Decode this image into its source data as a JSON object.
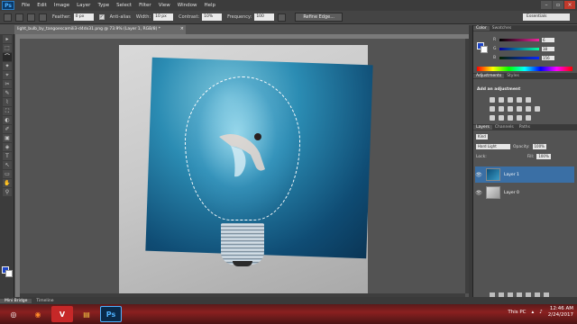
{
  "app": {
    "logo": "Ps"
  },
  "menu": [
    "File",
    "Edit",
    "Image",
    "Layer",
    "Type",
    "Select",
    "Filter",
    "View",
    "Window",
    "Help"
  ],
  "options": {
    "feather_label": "Feather:",
    "feather_value": "0 px",
    "antialias_label": "Anti-alias",
    "width_label": "Width:",
    "width_value": "10 px",
    "contrast_label": "Contrast:",
    "contrast_value": "10%",
    "frequency_label": "Frequency:",
    "frequency_value": "100",
    "refine_label": "Refine Edge...",
    "workspace": "Essentials"
  },
  "document": {
    "tab_title": "light_bulb_by_tangoescamili3-d4dx31.png @ 73.9% (Layer 1, RGB/8) *",
    "close_glyph": "×"
  },
  "tools": [
    "▸",
    "⬚",
    "⌒",
    "✦",
    "⌖",
    "✂",
    "✎",
    "⌇",
    "⛶",
    "◐",
    "✐",
    "▣",
    "◈",
    "T",
    "↖",
    "▭",
    "✋",
    "⚲"
  ],
  "panels": {
    "color_tabs": [
      "Color",
      "Swatches"
    ],
    "color": {
      "r_label": "R",
      "r_value": "6",
      "g_label": "G",
      "g_value": "38",
      "b_label": "B",
      "b_value": "156"
    },
    "adj_tabs": [
      "Adjustments",
      "Styles"
    ],
    "adj_title": "Add an adjustment",
    "layers_tabs": [
      "Layers",
      "Channels",
      "Paths"
    ],
    "kind_label": "Kind",
    "blend_mode": "Hard Light",
    "opacity_label": "Opacity:",
    "opacity_value": "100%",
    "lock_label": "Lock:",
    "fill_label": "Fill:",
    "fill_value": "100%",
    "layers": [
      {
        "name": "Layer 1",
        "selected": true
      },
      {
        "name": "Layer 0",
        "selected": false
      }
    ]
  },
  "statusbar": {
    "tabs": [
      "Mini Bridge",
      "Timeline"
    ]
  },
  "taskbar": {
    "items": [
      "◎",
      "◉",
      "V",
      "▤",
      "Ps"
    ],
    "tray_label": "This PC",
    "time": "12:46 AM",
    "date": "2/24/2017"
  },
  "colors": {
    "foreground": "#1d44c6",
    "background": "#ffffff",
    "selection": "#3a6fa5"
  }
}
